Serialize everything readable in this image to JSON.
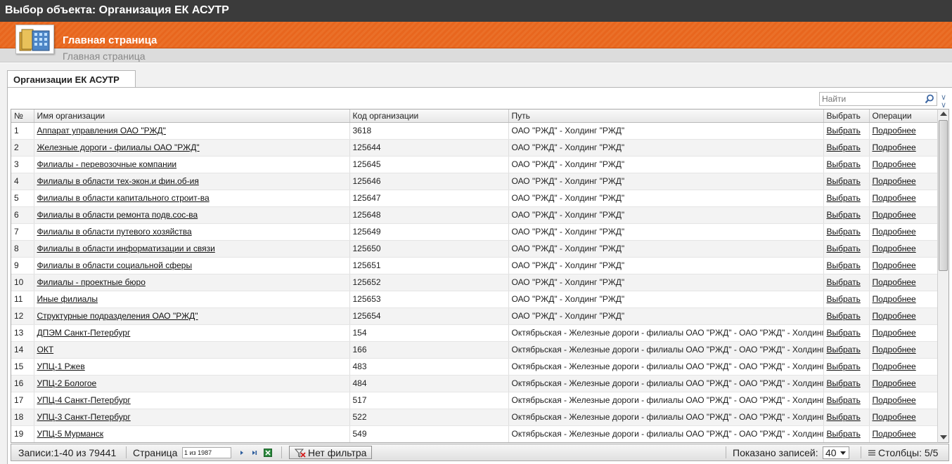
{
  "window": {
    "title": "Выбор объекта: Организация ЕК АСУТР"
  },
  "banner": {
    "title": "Главная страница",
    "breadcrumb": "Главная страница"
  },
  "tabs": [
    {
      "label": "Организации ЕК АСУТР",
      "active": true
    }
  ],
  "search": {
    "placeholder": "Найти"
  },
  "table": {
    "columns": [
      "№",
      "Имя организации",
      "Код организации",
      "Путь",
      "Выбрать",
      "Операции"
    ],
    "rows": [
      {
        "num": "1",
        "name": "Аппарат управления ОАО \"РЖД\"",
        "code": "3618",
        "path": "ОАО \"РЖД\" - Холдинг \"РЖД\"",
        "select": "Выбрать",
        "ops": "Подробнее"
      },
      {
        "num": "2",
        "name": "Железные дороги - филиалы  ОАО \"РЖД\"",
        "code": "125644",
        "path": "ОАО \"РЖД\" - Холдинг \"РЖД\"",
        "select": "Выбрать",
        "ops": "Подробнее"
      },
      {
        "num": "3",
        "name": "Филиалы - перевозочные компании",
        "code": "125645",
        "path": "ОАО \"РЖД\" - Холдинг \"РЖД\"",
        "select": "Выбрать",
        "ops": "Подробнее"
      },
      {
        "num": "4",
        "name": "Филиалы в области тех-экон.и фин.об-ия",
        "code": "125646",
        "path": "ОАО \"РЖД\" - Холдинг \"РЖД\"",
        "select": "Выбрать",
        "ops": "Подробнее"
      },
      {
        "num": "5",
        "name": "Филиалы в области капитального строит-ва",
        "code": "125647",
        "path": "ОАО \"РЖД\" - Холдинг \"РЖД\"",
        "select": "Выбрать",
        "ops": "Подробнее"
      },
      {
        "num": "6",
        "name": "Филиалы в области ремонта подв.сос-ва",
        "code": "125648",
        "path": "ОАО \"РЖД\" - Холдинг \"РЖД\"",
        "select": "Выбрать",
        "ops": "Подробнее"
      },
      {
        "num": "7",
        "name": "Филиалы в области путевого хозяйства",
        "code": "125649",
        "path": "ОАО \"РЖД\" - Холдинг \"РЖД\"",
        "select": "Выбрать",
        "ops": "Подробнее"
      },
      {
        "num": "8",
        "name": "Филиалы в области информатизации и связи",
        "code": "125650",
        "path": "ОАО \"РЖД\" - Холдинг \"РЖД\"",
        "select": "Выбрать",
        "ops": "Подробнее"
      },
      {
        "num": "9",
        "name": "Филиалы в области социальной сферы",
        "code": "125651",
        "path": "ОАО \"РЖД\" - Холдинг \"РЖД\"",
        "select": "Выбрать",
        "ops": "Подробнее"
      },
      {
        "num": "10",
        "name": "Филиалы - проектные бюро",
        "code": "125652",
        "path": "ОАО \"РЖД\" - Холдинг \"РЖД\"",
        "select": "Выбрать",
        "ops": "Подробнее"
      },
      {
        "num": "11",
        "name": "Иные филиалы",
        "code": "125653",
        "path": "ОАО \"РЖД\" - Холдинг \"РЖД\"",
        "select": "Выбрать",
        "ops": "Подробнее"
      },
      {
        "num": "12",
        "name": "Структурные подразделения  ОАО \"РЖД\"",
        "code": "125654",
        "path": "ОАО \"РЖД\" - Холдинг \"РЖД\"",
        "select": "Выбрать",
        "ops": "Подробнее"
      },
      {
        "num": "13",
        "name": "ДПЭМ Санкт-Петербург",
        "code": "154",
        "path": "Октябрьская - Железные дороги - филиалы ОАО \"РЖД\" - ОАО \"РЖД\" - Холдинг \"РЖД\"",
        "select": "Выбрать",
        "ops": "Подробнее"
      },
      {
        "num": "14",
        "name": "ОКТ",
        "code": "166",
        "path": "Октябрьская - Железные дороги - филиалы ОАО \"РЖД\" - ОАО \"РЖД\" - Холдинг \"РЖД\"",
        "select": "Выбрать",
        "ops": "Подробнее"
      },
      {
        "num": "15",
        "name": "УПЦ-1 Ржев",
        "code": "483",
        "path": "Октябрьская - Железные дороги - филиалы ОАО \"РЖД\" - ОАО \"РЖД\" - Холдинг \"РЖД\"",
        "select": "Выбрать",
        "ops": "Подробнее"
      },
      {
        "num": "16",
        "name": "УПЦ-2 Бологое",
        "code": "484",
        "path": "Октябрьская - Железные дороги - филиалы ОАО \"РЖД\" - ОАО \"РЖД\" - Холдинг \"РЖД\"",
        "select": "Выбрать",
        "ops": "Подробнее"
      },
      {
        "num": "17",
        "name": "УПЦ-4 Санкт-Петербург",
        "code": "517",
        "path": "Октябрьская - Железные дороги - филиалы ОАО \"РЖД\" - ОАО \"РЖД\" - Холдинг \"РЖД\"",
        "select": "Выбрать",
        "ops": "Подробнее"
      },
      {
        "num": "18",
        "name": "УПЦ-3 Санкт-Петербург",
        "code": "522",
        "path": "Октябрьская - Железные дороги - филиалы ОАО \"РЖД\" - ОАО \"РЖД\" - Холдинг \"РЖД\"",
        "select": "Выбрать",
        "ops": "Подробнее"
      },
      {
        "num": "19",
        "name": "УПЦ-5 Мурманск",
        "code": "549",
        "path": "Октябрьская - Железные дороги - филиалы ОАО \"РЖД\" - ОАО \"РЖД\" - Холдинг \"РЖД\"",
        "select": "Выбрать",
        "ops": "Подробнее"
      }
    ]
  },
  "footer": {
    "records": "Записи:1-40 из 79441",
    "page_label": "Страница",
    "page_value": "1 из 1987",
    "filter_label": "Нет фильтра",
    "shown_label": "Показано записей:",
    "page_size": "40",
    "columns_label": "Столбцы: 5/5"
  },
  "colors": {
    "banner": "#e8661e",
    "titlebar": "#3b3b3b",
    "accent_icon": "#5c7da6"
  }
}
